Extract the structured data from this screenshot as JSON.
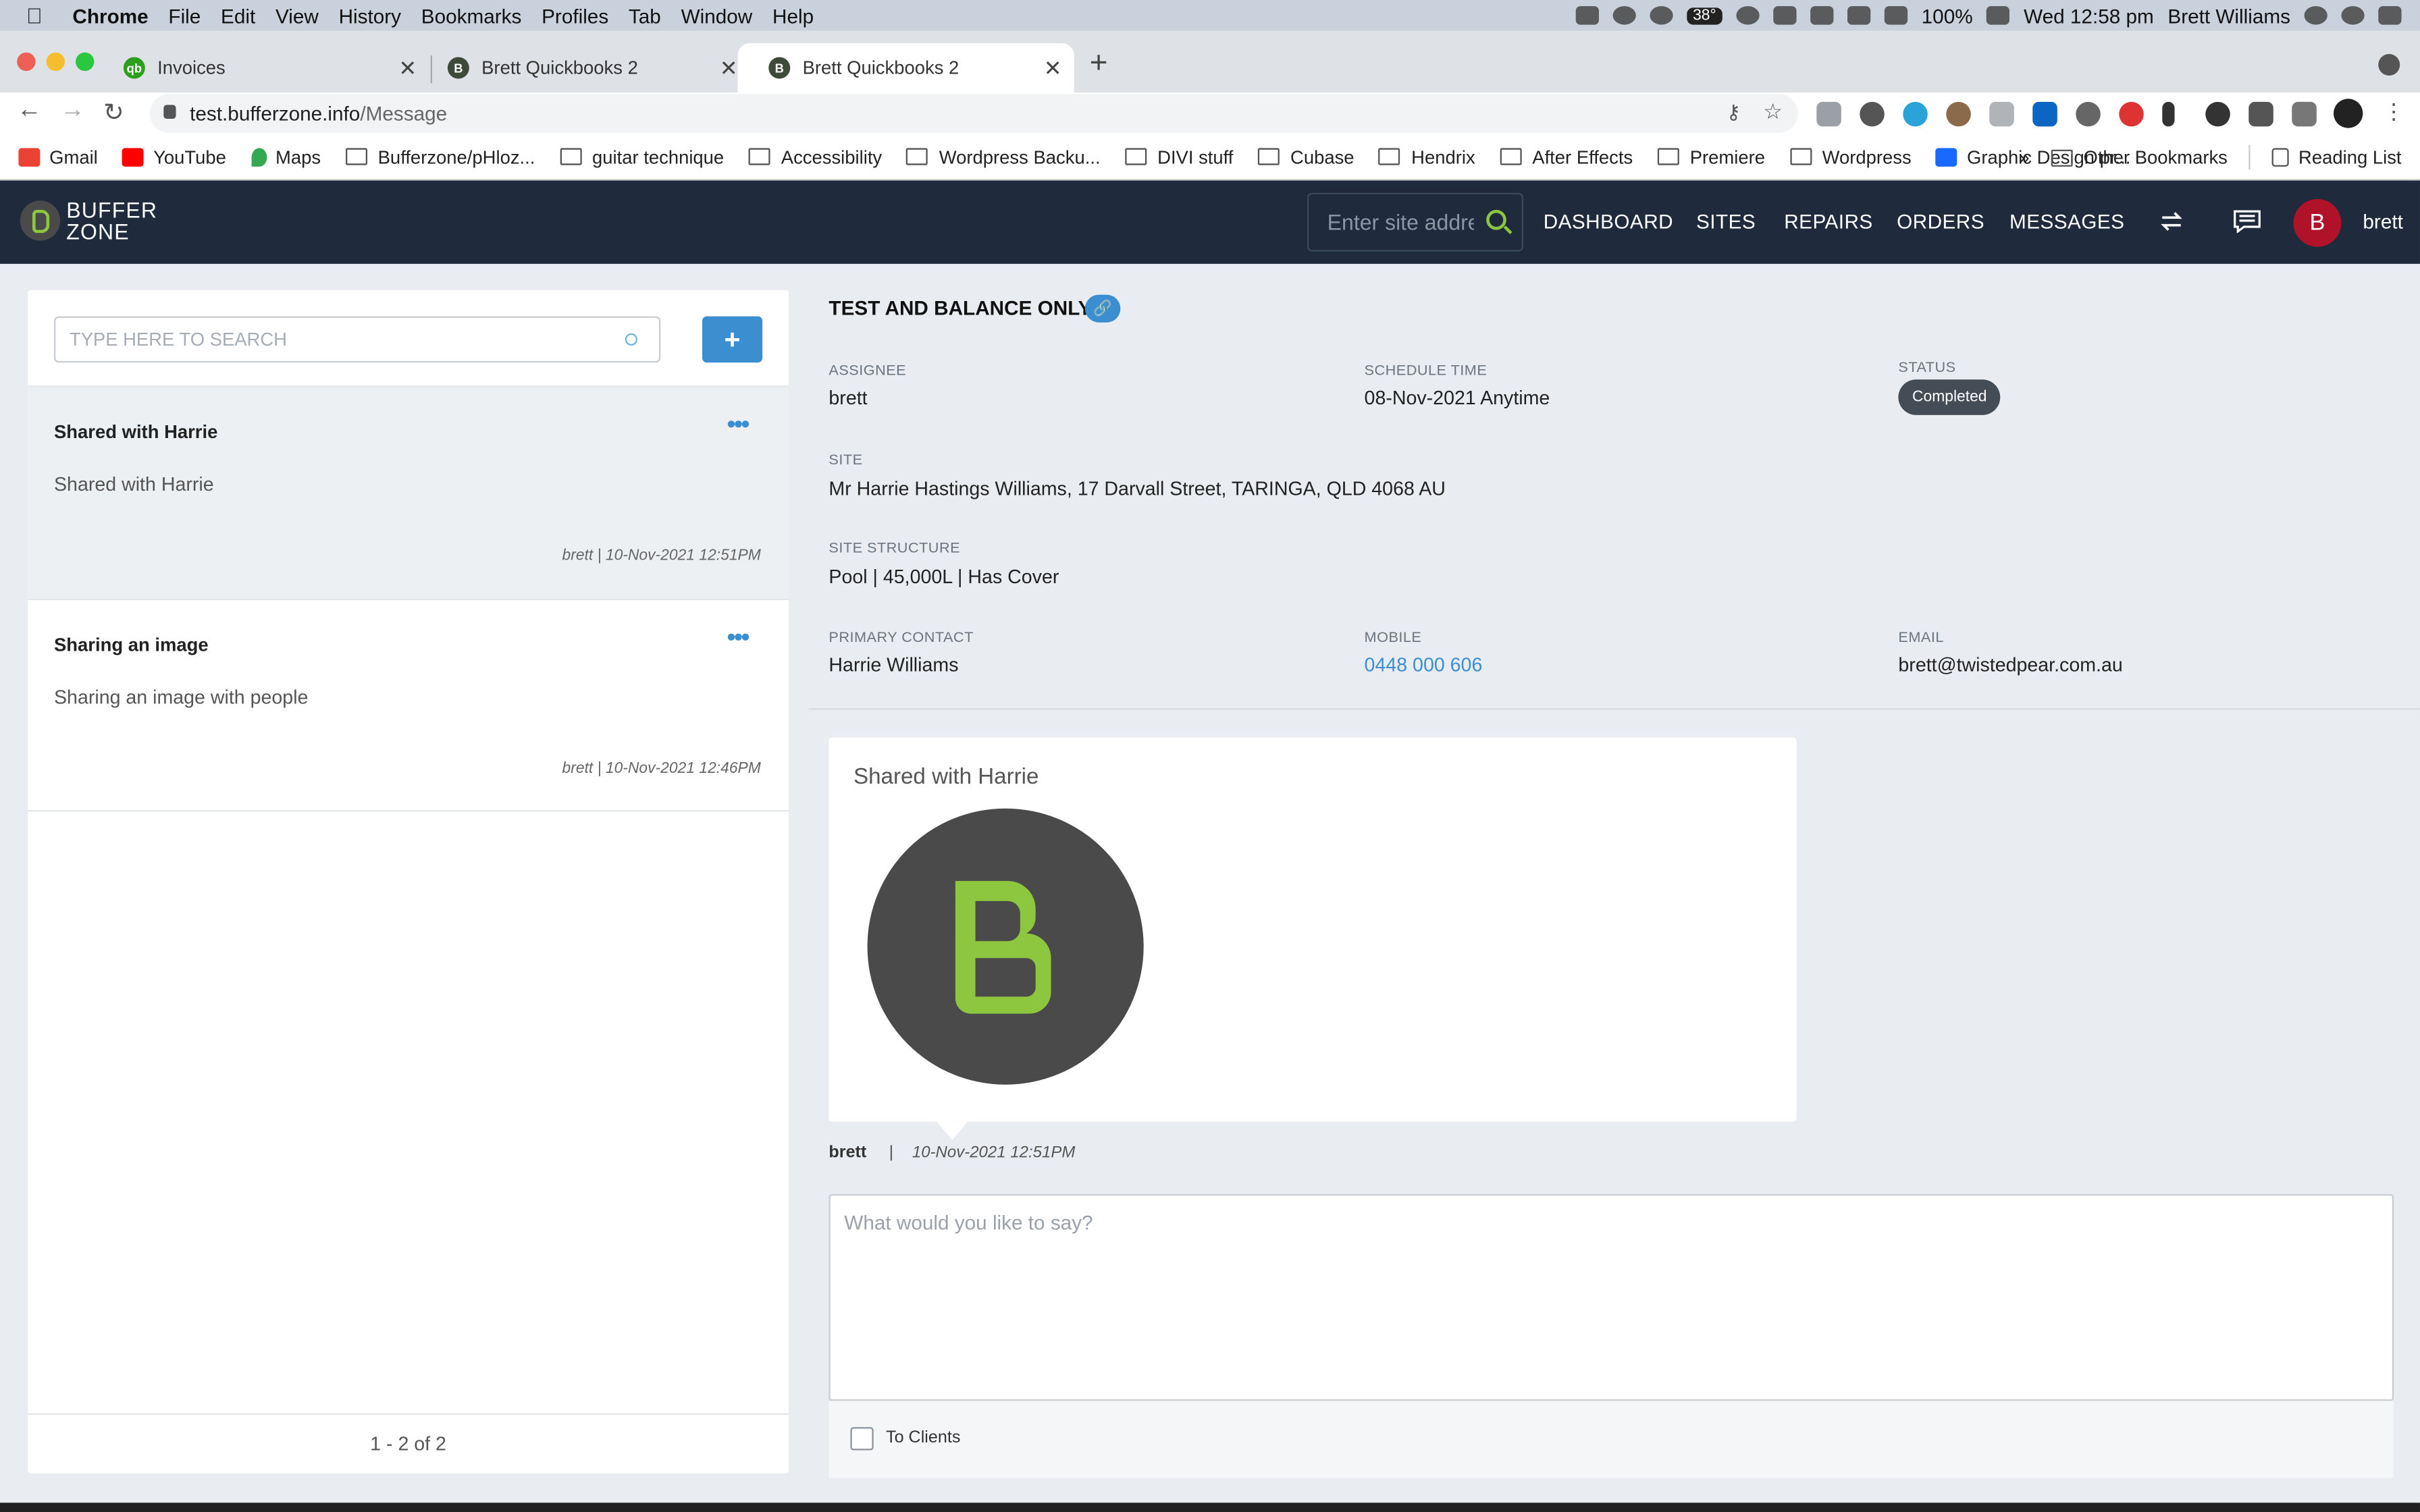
{
  "menubar": {
    "app": "Chrome",
    "items": [
      "File",
      "Edit",
      "View",
      "History",
      "Bookmarks",
      "Profiles",
      "Tab",
      "Window",
      "Help"
    ],
    "temp": "38°",
    "battery": "100%",
    "clock": "Wed 12:58 pm",
    "user": "Brett Williams"
  },
  "tabs": [
    {
      "title": "Invoices",
      "favicon_color": "#2ca01c"
    },
    {
      "title": "Brett Quickbooks 2",
      "favicon_color": "#3d4a3a"
    },
    {
      "title": "Brett Quickbooks 2",
      "favicon_color": "#3d4a3a"
    }
  ],
  "omnibox": {
    "host": "test.bufferzone.info",
    "path": "/Message"
  },
  "bookmarks": {
    "items": [
      "Gmail",
      "YouTube",
      "Maps",
      "Bufferzone/pHloz...",
      "guitar technique",
      "Accessibility",
      "Wordpress Backu...",
      "DIVI stuff",
      "Cubase",
      "Hendrix",
      "After Effects",
      "Premiere",
      "Wordpress",
      "Graphic Design pr..."
    ],
    "more": "»",
    "other": "Other Bookmarks",
    "reading": "Reading List"
  },
  "header": {
    "logo_line1": "BUFFER",
    "logo_line2": "ZONE",
    "search_placeholder": "Enter site address",
    "nav": [
      "DASHBOARD",
      "SITES",
      "REPAIRS",
      "ORDERS",
      "MESSAGES"
    ],
    "avatar_letter": "B",
    "username": "brett",
    "accent": "#8dc63f"
  },
  "sidebar": {
    "search_placeholder": "TYPE HERE TO SEARCH",
    "add_label": "+",
    "messages": [
      {
        "title": "Shared with Harrie",
        "body": "Shared with Harrie",
        "meta": "brett | 10-Nov-2021 12:51PM",
        "selected": true
      },
      {
        "title": "Sharing an image",
        "body": "Sharing an image with people",
        "meta": "brett | 10-Nov-2021 12:46PM",
        "selected": false
      }
    ],
    "pager": "1 - 2 of 2"
  },
  "job": {
    "title": "TEST AND BALANCE ONLY",
    "assignee_label": "ASSIGNEE",
    "assignee": "brett",
    "schedule_label": "SCHEDULE TIME",
    "schedule": "08-Nov-2021 Anytime",
    "status_label": "STATUS",
    "status": "Completed",
    "site_label": "SITE",
    "site": "Mr Harrie Hastings Williams, 17 Darvall Street, TARINGA, QLD 4068 AU",
    "structure_label": "SITE STRUCTURE",
    "structure": "Pool | 45,000L | Has Cover",
    "contact_label": "PRIMARY CONTACT",
    "contact": "Harrie Williams",
    "mobile_label": "MOBILE",
    "mobile": "0448 000 606",
    "email_label": "EMAIL",
    "email": "brett@twistedpear.com.au"
  },
  "message": {
    "title": "Shared with Harrie",
    "author": "brett",
    "separator": "|",
    "timestamp": "10-Nov-2021 12:51PM"
  },
  "compose": {
    "placeholder": "What would you like to say?",
    "to_clients_label": "To Clients"
  }
}
